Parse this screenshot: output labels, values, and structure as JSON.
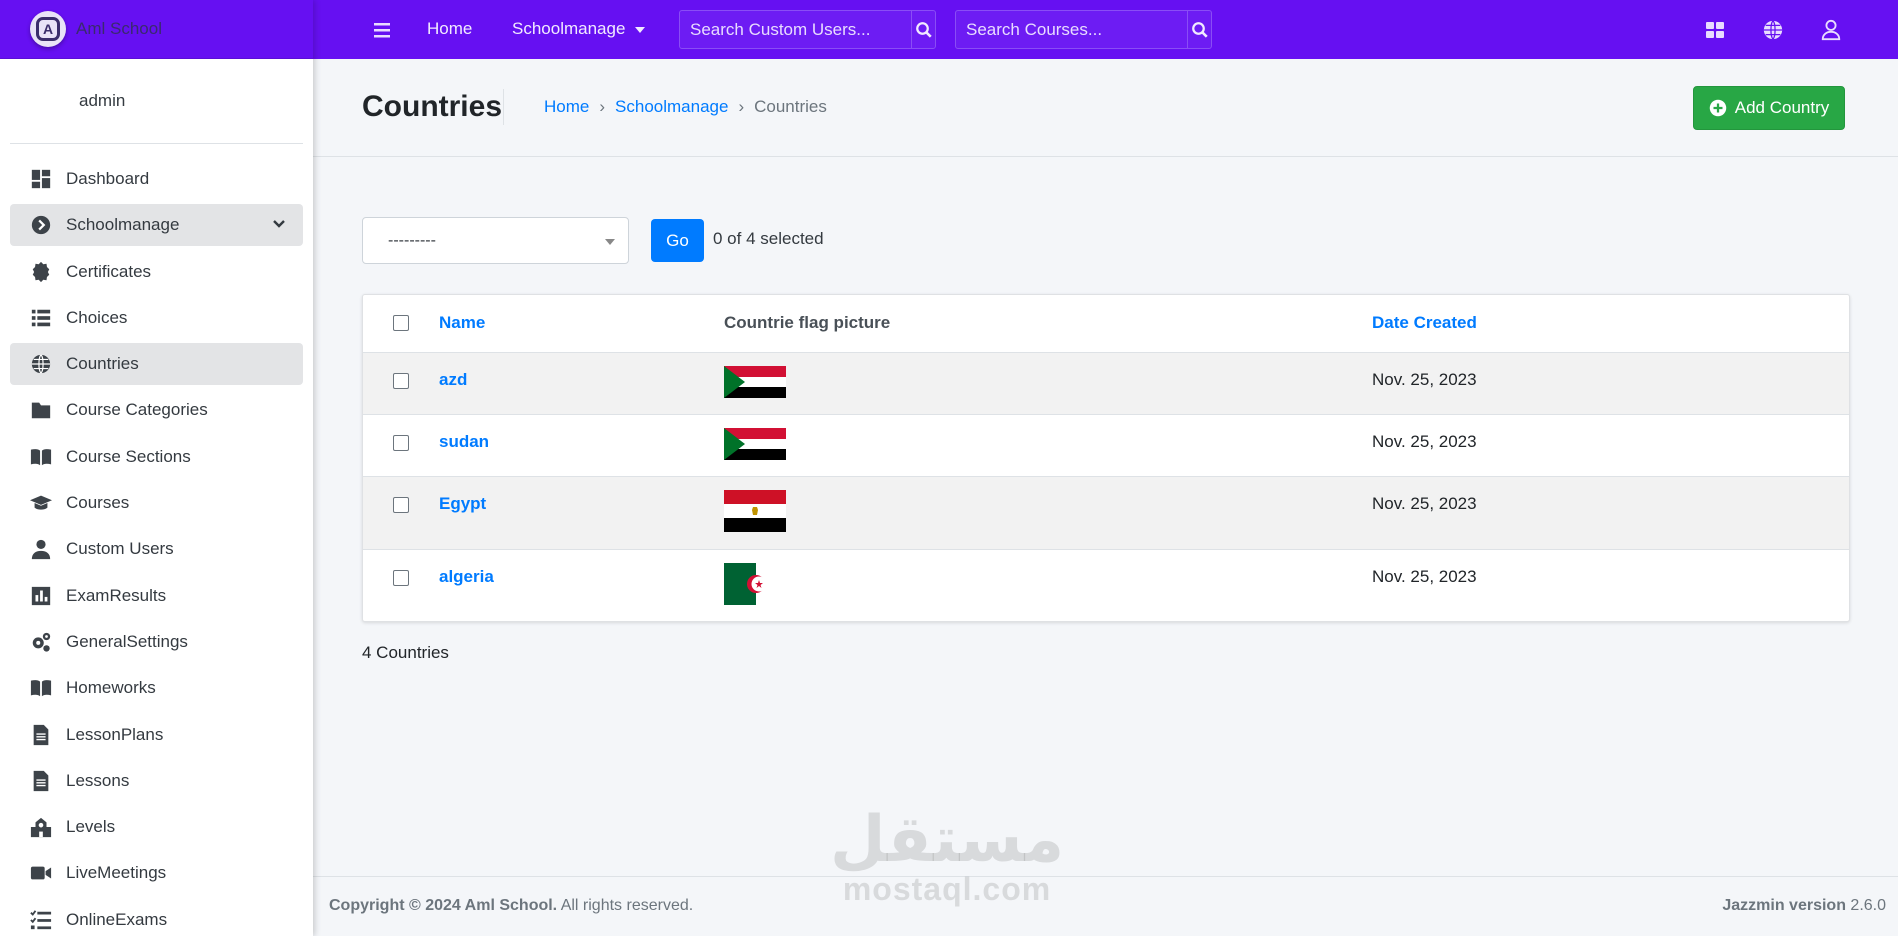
{
  "brand": {
    "logo_letter": "A",
    "name": "Aml School"
  },
  "user": {
    "name": "admin"
  },
  "sidebar": {
    "items": [
      {
        "label": "Dashboard",
        "icon": "dashboard-icon"
      },
      {
        "label": "Schoolmanage",
        "icon": "chevron-circle-right-icon",
        "expanded": true
      },
      {
        "label": "Certificates",
        "icon": "certificate-icon"
      },
      {
        "label": "Choices",
        "icon": "list-icon"
      },
      {
        "label": "Countries",
        "icon": "globe-icon",
        "active": true
      },
      {
        "label": "Course Categories",
        "icon": "folder-icon"
      },
      {
        "label": "Course Sections",
        "icon": "book-open-icon"
      },
      {
        "label": "Courses",
        "icon": "graduation-cap-icon"
      },
      {
        "label": "Custom Users",
        "icon": "user-icon"
      },
      {
        "label": "ExamResults",
        "icon": "poll-icon"
      },
      {
        "label": "GeneralSettings",
        "icon": "cogs-icon"
      },
      {
        "label": "Homeworks",
        "icon": "book-open-icon"
      },
      {
        "label": "LessonPlans",
        "icon": "file-alt-icon"
      },
      {
        "label": "Lessons",
        "icon": "file-alt-icon"
      },
      {
        "label": "Levels",
        "icon": "school-icon"
      },
      {
        "label": "LiveMeetings",
        "icon": "video-icon"
      },
      {
        "label": "OnlineExams",
        "icon": "tasks-icon"
      }
    ]
  },
  "topbar": {
    "home_label": "Home",
    "schoolmanage_label": "Schoolmanage",
    "search_users_placeholder": "Search Custom Users...",
    "search_courses_placeholder": "Search Courses..."
  },
  "header": {
    "title": "Countries",
    "breadcrumb": {
      "home": "Home",
      "app": "Schoolmanage",
      "current": "Countries",
      "separator": "›"
    },
    "add_button": "Add Country"
  },
  "actions": {
    "select_value": "---------",
    "go_label": "Go",
    "selected_text": "0 of 4 selected"
  },
  "table": {
    "columns": [
      "Name",
      "Countrie flag picture",
      "Date Created"
    ],
    "rows": [
      {
        "name": "azd",
        "flag": "sudan-flag",
        "date": "Nov. 25, 2023"
      },
      {
        "name": "sudan",
        "flag": "sudan-flag",
        "date": "Nov. 25, 2023"
      },
      {
        "name": "Egypt",
        "flag": "egypt-flag",
        "date": "Nov. 25, 2023"
      },
      {
        "name": "algeria",
        "flag": "algeria-flag",
        "date": "Nov. 25, 2023"
      }
    ],
    "result_count": "4 Countries"
  },
  "footer": {
    "copyright": "Copyright © 2024 Aml School.",
    "rights": " All rights reserved.",
    "version_label": "Jazzmin version",
    "version": " 2.6.0"
  },
  "watermark": {
    "arabic": "مستقل",
    "latin": "mostaql.com"
  },
  "colors": {
    "navbar": "#6610f2",
    "link": "#007bff",
    "success": "#28a745",
    "primary": "#007bff"
  }
}
